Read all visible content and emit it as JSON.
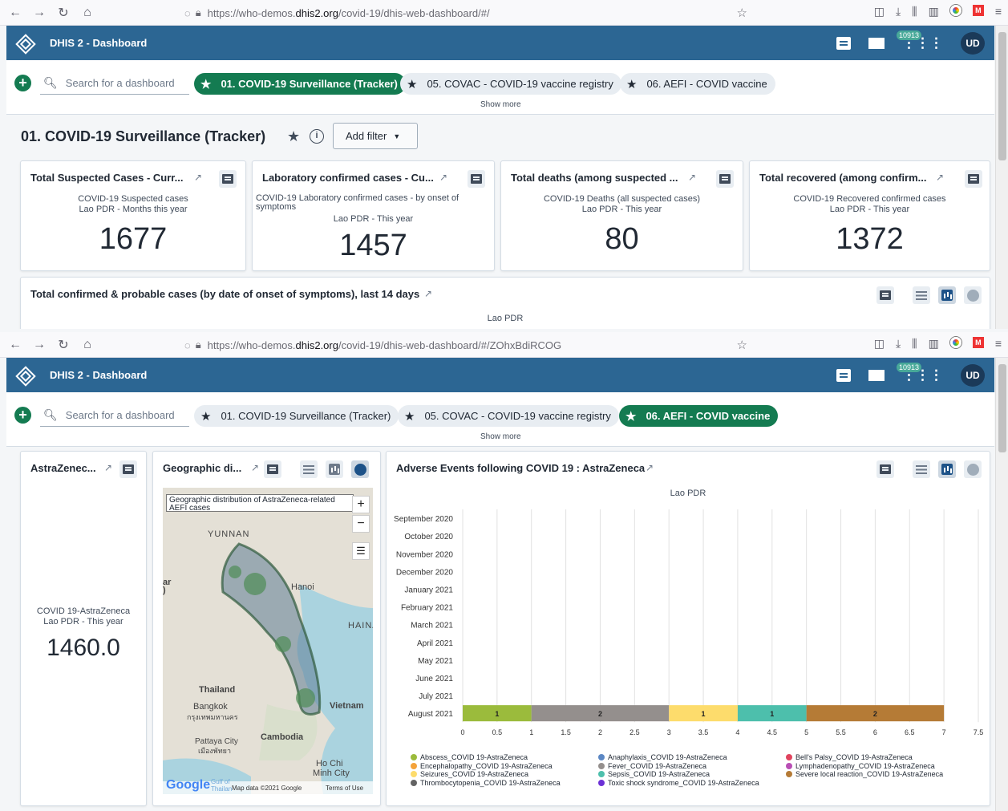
{
  "browser_top": {
    "url_prefix": "https://who-demos.",
    "url_domain": "dhis2.org",
    "url_suffix": "/covid-19/dhis-web-dashboard/#/"
  },
  "browser_bottom": {
    "url_prefix": "https://who-demos.",
    "url_domain": "dhis2.org",
    "url_suffix": "/covid-19/dhis-web-dashboard/#/ZOhxBdiRCOG"
  },
  "header": {
    "app_title": "DHIS 2 - Dashboard",
    "mail_count": "10913",
    "avatar": "UD",
    "apps_icon": "⋮⋮⋮"
  },
  "dashbar": {
    "search_placeholder": "Search for a dashboard",
    "chips": [
      "01. COVID-19 Surveillance (Tracker)",
      "05. COVAC - COVID-19 vaccine registry",
      "06. AEFI - COVID vaccine"
    ],
    "show_more": "Show more"
  },
  "dashboard_top": {
    "title": "01. COVID-19 Surveillance (Tracker)",
    "add_filter": "Add filter",
    "cards": [
      {
        "title": "Total Suspected Cases - Curr...",
        "line1": "COVID-19 Suspected cases",
        "line2": "Lao PDR - Months this year",
        "value": "1677"
      },
      {
        "title": "Laboratory confirmed cases - Cu...",
        "line1": "COVID-19 Laboratory confirmed cases - by onset of symptoms",
        "line2": "Lao PDR - This year",
        "value": "1457"
      },
      {
        "title": "Total deaths (among suspected ...",
        "line1": "COVID-19 Deaths (all suspected cases)",
        "line2": "Lao PDR - This year",
        "value": "80"
      },
      {
        "title": "Total recovered (among confirm...",
        "line1": "COVID-19 Recovered confirmed cases",
        "line2": "Lao PDR - This year",
        "value": "1372"
      }
    ],
    "wide_card": {
      "title": "Total confirmed & probable cases (by date of onset of symptoms), last 14 days",
      "subtitle": "Lao PDR"
    }
  },
  "dashboard_bottom": {
    "sv_card": {
      "title": "AstraZenec...",
      "line1": "COVID 19-AstraZeneca",
      "line2": "Lao PDR - This year",
      "value": "1460.0"
    },
    "map_card": {
      "title": "Geographic di...",
      "map_title": "Geographic distribution of AstraZeneca-related AEFI cases",
      "labels": [
        "YUNNAN",
        "Hanoi",
        "HAINA",
        "Thailand",
        "Bangkok",
        "กรุงเทพมหานคร",
        "Cambodia",
        "Pattaya City",
        "เมืองพัทยา",
        "Ho Chi",
        "Minh City",
        "Vietnam",
        "ar",
        ")"
      ],
      "google": "Google",
      "gulf": "Gulf of",
      "gulf2": "Thailan",
      "attribution": "Map data ©2021 Google",
      "terms": "Terms of Use"
    },
    "chart_card": {
      "title": "Adverse Events following COVID 19 : AstraZeneca"
    }
  },
  "chart_data": {
    "type": "bar",
    "orientation": "horizontal-stacked",
    "title": "Lao PDR",
    "categories": [
      "September 2020",
      "October 2020",
      "November 2020",
      "December 2020",
      "January 2021",
      "February 2021",
      "March 2021",
      "April 2021",
      "May 2021",
      "June 2021",
      "July 2021",
      "August 2021"
    ],
    "xlim": [
      0,
      7.5
    ],
    "xticks": [
      "0",
      "0.5",
      "1",
      "1.5",
      "2",
      "2.5",
      "3",
      "3.5",
      "4",
      "4.5",
      "5",
      "5.5",
      "6",
      "6.5",
      "7",
      "7.5"
    ],
    "grid": true,
    "legend_position": "bottom",
    "series": [
      {
        "name": "Abscess_COVID 19-AstraZeneca",
        "color": "#9bbb3c",
        "values": [
          0,
          0,
          0,
          0,
          0,
          0,
          0,
          0,
          0,
          0,
          0,
          1
        ]
      },
      {
        "name": "Anaphylaxis_COVID 19-AstraZeneca",
        "color": "#5b87c4",
        "values": [
          0,
          0,
          0,
          0,
          0,
          0,
          0,
          0,
          0,
          0,
          0,
          0
        ]
      },
      {
        "name": "Bell's Palsy_COVID 19-AstraZeneca",
        "color": "#e0445e",
        "values": [
          0,
          0,
          0,
          0,
          0,
          0,
          0,
          0,
          0,
          0,
          0,
          0
        ]
      },
      {
        "name": "Encephalopathy_COVID 19-AstraZeneca",
        "color": "#f4a33a",
        "values": [
          0,
          0,
          0,
          0,
          0,
          0,
          0,
          0,
          0,
          0,
          0,
          0
        ]
      },
      {
        "name": "Fever_COVID 19-AstraZeneca",
        "color": "#948f8d",
        "values": [
          0,
          0,
          0,
          0,
          0,
          0,
          0,
          0,
          0,
          0,
          0,
          2
        ]
      },
      {
        "name": "Lymphadenopathy_COVID 19-AstraZeneca",
        "color": "#b94fb5",
        "values": [
          0,
          0,
          0,
          0,
          0,
          0,
          0,
          0,
          0,
          0,
          0,
          0
        ]
      },
      {
        "name": "Seizures_COVID 19-AstraZeneca",
        "color": "#fddc6c",
        "values": [
          0,
          0,
          0,
          0,
          0,
          0,
          0,
          0,
          0,
          0,
          0,
          1
        ]
      },
      {
        "name": "Sepsis_COVID 19-AstraZeneca",
        "color": "#4dbfac",
        "values": [
          0,
          0,
          0,
          0,
          0,
          0,
          0,
          0,
          0,
          0,
          0,
          1
        ]
      },
      {
        "name": "Severe local reaction_COVID 19-AstraZeneca",
        "color": "#b57b36",
        "values": [
          0,
          0,
          0,
          0,
          0,
          0,
          0,
          0,
          0,
          0,
          0,
          2
        ]
      },
      {
        "name": "Thrombocytopenia_COVID 19-AstraZeneca",
        "color": "#636363",
        "values": [
          0,
          0,
          0,
          0,
          0,
          0,
          0,
          0,
          0,
          0,
          0,
          0
        ]
      },
      {
        "name": "Toxic shock syndrome_COVID 19-AstraZeneca",
        "color": "#6c31d6",
        "values": [
          0,
          0,
          0,
          0,
          0,
          0,
          0,
          0,
          0,
          0,
          0,
          0
        ]
      }
    ]
  }
}
